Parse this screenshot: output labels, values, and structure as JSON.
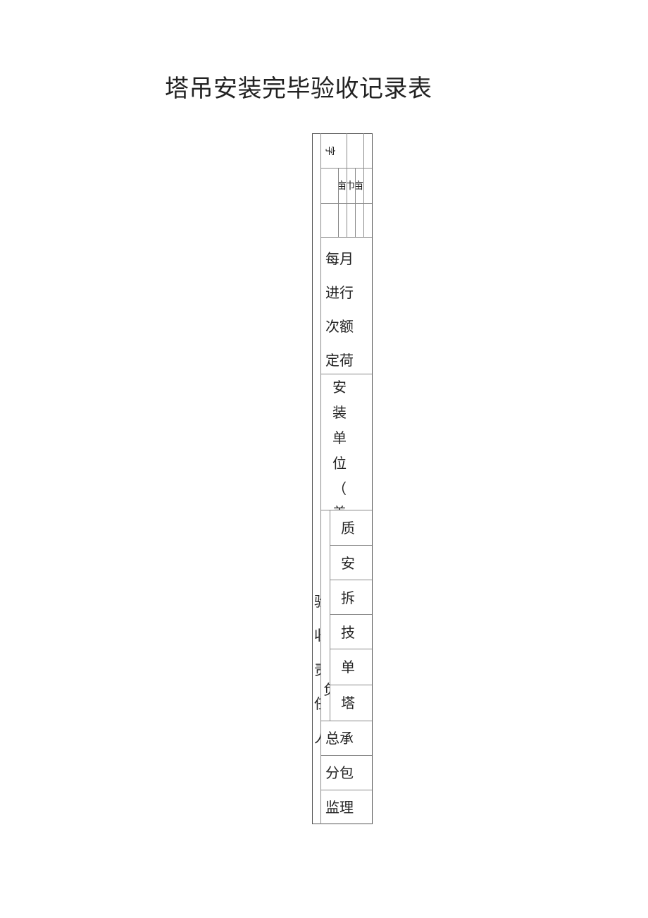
{
  "document": {
    "title": "塔吊安装完毕验收记录表"
  },
  "table": {
    "top_rows": {
      "row1_cell_text": "字",
      "row2_cells": [
        "亩",
        "巾",
        "亩"
      ]
    },
    "monthly_section": {
      "lines": [
        "每月",
        "进行",
        "次额",
        "定荷"
      ]
    },
    "install_unit_section": {
      "chars": [
        "安",
        "装",
        "单",
        "位",
        "（",
        "盖"
      ]
    },
    "signature_section": {
      "left_label_chars": [
        "验",
        "收",
        "责",
        "任",
        "人"
      ],
      "sub_label_char": "负",
      "rows": [
        "质",
        "安",
        "拆",
        "技",
        "单",
        "塔"
      ]
    },
    "bottom_rows": [
      "总承",
      "分包",
      "监理"
    ]
  }
}
